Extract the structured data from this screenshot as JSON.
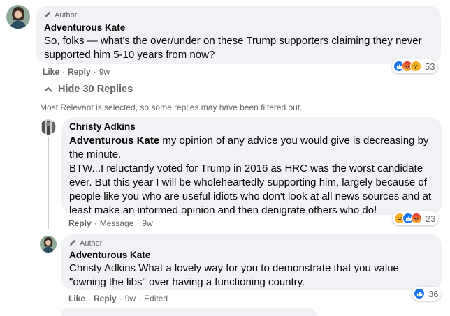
{
  "comments": [
    {
      "author_badge": "Author",
      "name": "Adventurous Kate",
      "text": "So, folks — what's the over/under on these Trump supporters claiming they never supported him 5-10 years from now?",
      "actions": [
        "Like",
        "Reply"
      ],
      "time": "9w",
      "reaction_count": "53",
      "reactions": [
        "like-icon",
        "angry-icon",
        "wow-icon"
      ]
    }
  ],
  "replies_toggle": "Hide 30 Replies",
  "filter_note": "Most Relevant is selected, so some replies may have been filtered out.",
  "replies": [
    {
      "name": "Christy Adkins",
      "mention": "Adventurous Kate",
      "text_first": " my opinion of any advice you would give is decreasing by the minute.",
      "text_rest": "BTW...I reluctantly voted for Trump in 2016 as HRC was the worst candidate ever. But this year I will be wholeheartedly supporting him, largely because of people like you who are useful idiots who don't look at all news sources and at least make an informed opinion and then denigrate others who do!",
      "actions": [
        "Reply",
        "Message"
      ],
      "time": "9w",
      "reaction_count": "23",
      "reactions": [
        "haha-icon",
        "like-icon",
        "angry-icon"
      ]
    },
    {
      "author_badge": "Author",
      "name": "Adventurous Kate",
      "text": "Christy Adkins What a lovely way for you to demonstrate that you value \"owning the libs\" over having a functioning country.",
      "actions": [
        "Like",
        "Reply"
      ],
      "time": "9w",
      "edited": "Edited",
      "reaction_count": "36",
      "reactions": [
        "like-icon"
      ]
    }
  ],
  "colors": {
    "bubble": "#f0f2f5",
    "meta": "#65676b",
    "like": "#1877f2",
    "angry": "#e9710f",
    "wow": "#f7b125"
  }
}
